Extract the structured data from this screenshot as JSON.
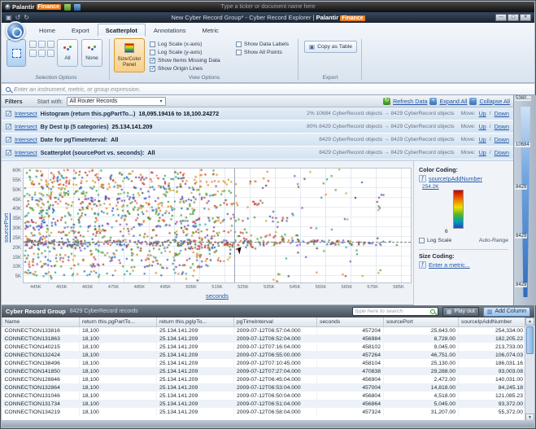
{
  "icons": {
    "save": "▣",
    "undo": "↺",
    "redo": "↻",
    "minimize": "—",
    "maximize": "▢",
    "close": "✕",
    "dropdown": "▾",
    "refresh": "↻",
    "expand": "+",
    "collapse": "−",
    "metric": "ƒ",
    "copy": "▣",
    "play": "▦",
    "add_column": "▥",
    "up": "▲",
    "down": "▼"
  },
  "titlebar": {
    "logo_text": "Palantir",
    "logo_badge": "Finance",
    "search_hint": "Type a ticker or document name here",
    "window_title": "New Cyber Record Group* - Cyber Record Explorer  |",
    "window_brand": "Palantir",
    "window_brand2": "Finance"
  },
  "ribbon": {
    "tabs": [
      {
        "label": "Home"
      },
      {
        "label": "Export"
      },
      {
        "label": "Scatterplot"
      },
      {
        "label": "Annotations"
      },
      {
        "label": "Metric"
      }
    ],
    "groups": {
      "selection": "Selection Options",
      "view": "View Options",
      "export": "Export"
    },
    "buttons": {
      "all": "All",
      "none": "None",
      "size_color": "Size/Color Panel",
      "copy_as_table": "Copy as Table"
    },
    "view_checks_col1": [
      {
        "label": "Log Scale (x-axis)",
        "checked": false
      },
      {
        "label": "Log Scale (y-axis)",
        "checked": false
      },
      {
        "label": "Show Items Missing Data",
        "checked": true
      },
      {
        "label": "Show Origin Lines",
        "checked": true
      }
    ],
    "view_checks_col2": [
      {
        "label": "Show Data Labels",
        "checked": false
      },
      {
        "label": "Show All Points",
        "checked": false
      }
    ]
  },
  "expression_bar": {
    "hint": "Enter an instrument, metric, or group expression."
  },
  "filters": {
    "panel_title": "Filters",
    "start_with_label": "Start with:",
    "start_with_value": "All Router Records",
    "refresh_label": "Refresh Data",
    "expand_label": "Expand All",
    "collapse_label": "Collapse All",
    "move_label": "Move:",
    "up_label": "Up",
    "down_label": "Down",
    "rows": [
      {
        "checked": true,
        "op": "Intersect",
        "name": "Histogram (return this.pgPartTo...)",
        "value": "18,095.19416 to 18,100.24272",
        "stats": "2%   10684 CyberRecord objects → 8429 CyberRecord objects"
      },
      {
        "checked": true,
        "op": "Intersect",
        "name": "By Dest Ip (5 categories)",
        "value": "25.134.141.209",
        "stats": "80%   8429 CyberRecord objects → 8429 CyberRecord objects"
      },
      {
        "checked": true,
        "op": "Intersect",
        "name": "Date for pgTimeInterval:",
        "value": "All",
        "stats": "8429 CyberRecord objects → 8429 CyberRecord objects"
      },
      {
        "checked": true,
        "op": "Intersect",
        "name": "Scatterplot (sourcePort vs. seconds):",
        "value": "All",
        "stats": "8429 CyberRecord objects → 8429 CyberRecord objects"
      }
    ]
  },
  "scatter": {
    "y_axis_label": "sourcePort",
    "x_axis_label": "seconds",
    "y_ticks": [
      "60K",
      "55K",
      "50K",
      "45K",
      "40K",
      "35K",
      "30K",
      "25K",
      "20K",
      "15K",
      "10K",
      "5K"
    ],
    "x_ticks": [
      "445K",
      "455K",
      "465K",
      "475K",
      "485K",
      "495K",
      "505K",
      "515K",
      "525K",
      "535K",
      "545K",
      "555K",
      "565K",
      "575K",
      "585K"
    ]
  },
  "color_coding": {
    "title": "Color Coding:",
    "metric": "sourceIpAddNumber",
    "max_value": "254.2K",
    "min_value": "6",
    "log_scale_label": "Log Scale",
    "log_scale_checked": false,
    "auto_range_label": "Auto-Range"
  },
  "size_coding": {
    "title": "Size Coding:",
    "link": "Enter a metric..."
  },
  "right_strip": {
    "labels": [
      "5360...",
      "10684",
      "8429",
      "8429",
      "8429"
    ]
  },
  "table": {
    "title": "Cyber Record Group",
    "subtitle": "8429 CyberRecord records",
    "search_hint": "type here to search",
    "play_out_label": "Play out",
    "add_column_label": "Add Column",
    "columns": [
      "Name",
      "return this.pgPartTo...",
      "return this.pgIpTo...",
      "pgTimeInterval",
      "seconds",
      "sourcePort",
      "sourceIpAddNumber"
    ],
    "rows": [
      [
        "CONNECTION133816",
        "18,100",
        "25.134.141.209",
        "2009-07-12T06:57:04.000",
        "457204",
        "25,643.00",
        "254,334.00"
      ],
      [
        "CONNECTION131863",
        "18,100",
        "25.134.141.209",
        "2009-07-12T06:52:04.000",
        "456984",
        "8,728.00",
        "182,205.22"
      ],
      [
        "CONNECTION140215",
        "18,100",
        "25.134.141.209",
        "2009-07-12T07:16:04.000",
        "458102",
        "9,045.00",
        "213,733.00"
      ],
      [
        "CONNECTION132424",
        "18,100",
        "25.134.141.209",
        "2009-07-12T06:55:00.000",
        "457264",
        "46,751.00",
        "106,074.03"
      ],
      [
        "CONNECTION138496",
        "18,100",
        "25.134.141.209",
        "2009-07-12T07:10:45.000",
        "458104",
        "25,130.00",
        "186,031.16"
      ],
      [
        "CONNECTION141850",
        "18,100",
        "25.134.141.209",
        "2009-07-12T07:27:04.000",
        "470838",
        "29,288.00",
        "93,003.08"
      ],
      [
        "CONNECTION128846",
        "18,100",
        "25.134.141.209",
        "2009-07-12T06:45:04.000",
        "456904",
        "2,472.00",
        "140,031.00"
      ],
      [
        "CONNECTION132864",
        "18,100",
        "25.134.141.209",
        "2009-07-12T06:53:04.000",
        "457004",
        "14,818.00",
        "84,245.18"
      ],
      [
        "CONNECTION131046",
        "18,100",
        "25.134.141.209",
        "2009-07-12T06:50:04.000",
        "456804",
        "4,518.00",
        "121,085.23"
      ],
      [
        "CONNECTION131734",
        "18,100",
        "25.134.141.209",
        "2009-07-12T06:51:04.000",
        "456864",
        "5,045.00",
        "93,372.00"
      ],
      [
        "CONNECTION134219",
        "18,100",
        "25.134.141.209",
        "2009-07-12T06:58:04.000",
        "457324",
        "31,207.00",
        "55,372.00"
      ]
    ]
  },
  "scatter_visual": {
    "dash_line_y": 0.645,
    "vline_x": 0.545,
    "palette": {
      "red": "#c62f2f",
      "orange": "#e07a1f",
      "yellow": "#bfa018",
      "green": "#4a9428",
      "teal": "#1f9e8e",
      "blue": "#2a5fc0",
      "purple": "#6f42b8",
      "dark": "#3c4046"
    },
    "bands": [
      {
        "y": 0.03,
        "spread": 0.05,
        "x1": 0.5,
        "count": 45,
        "colors": [
          "red",
          "orange",
          "green"
        ]
      },
      {
        "y": 0.07,
        "spread": 0.04,
        "x1": 0.42,
        "count": 40,
        "colors": [
          "blue",
          "teal",
          "red"
        ]
      },
      {
        "y": 0.115,
        "spread": 0.05,
        "x1": 0.6,
        "count": 70,
        "colors": [
          "red",
          "orange",
          "yellow"
        ]
      },
      {
        "y": 0.16,
        "spread": 0.04,
        "x1": 0.5,
        "count": 55,
        "colors": [
          "green",
          "blue",
          "orange"
        ]
      },
      {
        "y": 0.21,
        "spread": 0.05,
        "x1": 0.55,
        "count": 65,
        "colors": [
          "green",
          "teal",
          "yellow"
        ]
      },
      {
        "y": 0.26,
        "spread": 0.04,
        "x1": 0.48,
        "count": 55,
        "colors": [
          "blue",
          "purple",
          "red"
        ]
      },
      {
        "y": 0.305,
        "spread": 0.05,
        "x1": 0.62,
        "count": 75,
        "colors": [
          "red",
          "orange",
          "green"
        ]
      },
      {
        "y": 0.35,
        "spread": 0.04,
        "x1": 0.5,
        "count": 55,
        "colors": [
          "orange",
          "green",
          "blue"
        ]
      },
      {
        "y": 0.395,
        "spread": 0.04,
        "x1": 0.44,
        "count": 45,
        "colors": [
          "teal",
          "blue",
          "green"
        ]
      },
      {
        "y": 0.445,
        "spread": 0.05,
        "x1": 0.68,
        "count": 85,
        "colors": [
          "red",
          "green",
          "blue",
          "orange"
        ]
      },
      {
        "y": 0.495,
        "spread": 0.04,
        "x1": 0.5,
        "count": 55,
        "colors": [
          "blue",
          "teal",
          "purple"
        ]
      },
      {
        "y": 0.545,
        "spread": 0.05,
        "x1": 0.58,
        "count": 65,
        "colors": [
          "green",
          "red",
          "yellow"
        ]
      },
      {
        "y": 0.6,
        "spread": 0.05,
        "x1": 0.72,
        "count": 75,
        "colors": [
          "orange",
          "blue",
          "red",
          "green"
        ]
      },
      {
        "y": 0.645,
        "spread": 0.045,
        "x1": 0.97,
        "count": 260,
        "colors": [
          "dark",
          "red",
          "blue",
          "green",
          "orange",
          "purple"
        ]
      },
      {
        "y": 0.685,
        "spread": 0.04,
        "x1": 0.6,
        "count": 75,
        "colors": [
          "red",
          "green",
          "blue"
        ]
      },
      {
        "y": 0.735,
        "spread": 0.05,
        "x1": 0.5,
        "count": 55,
        "colors": [
          "green",
          "orange",
          "teal"
        ]
      },
      {
        "y": 0.79,
        "spread": 0.05,
        "x1": 0.54,
        "count": 55,
        "colors": [
          "red",
          "blue",
          "yellow"
        ]
      },
      {
        "y": 0.85,
        "spread": 0.04,
        "x1": 0.48,
        "count": 45,
        "colors": [
          "purple",
          "red",
          "green"
        ]
      },
      {
        "y": 0.91,
        "spread": 0.05,
        "x1": 0.44,
        "count": 40,
        "colors": [
          "orange",
          "teal",
          "blue"
        ]
      }
    ],
    "noise_count": 170
  }
}
